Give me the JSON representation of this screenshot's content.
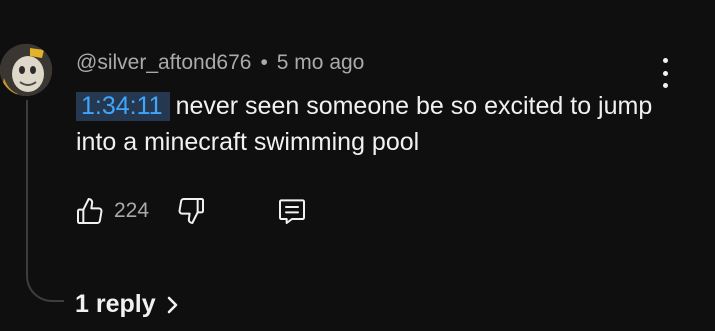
{
  "comment": {
    "author": "@silver_aftond676",
    "separator": "•",
    "age": "5 mo ago",
    "timestamp_link": "1:34:11",
    "text": "never seen someone be so excited to jump into a minecraft swimming pool",
    "like_count": "224",
    "reply_toggle": "1 reply"
  },
  "icons": {
    "like": "thumbs-up-icon",
    "dislike": "thumbs-down-icon",
    "reply": "comment-icon",
    "menu": "more-vertical-icon",
    "expand": "chevron-right-icon"
  },
  "colors": {
    "background": "#0f0f0f",
    "text": "#f1f1f1",
    "secondary_text": "#aaaaaa",
    "timestamp_link": "#3ea6ff",
    "timestamp_highlight": "#263850"
  }
}
